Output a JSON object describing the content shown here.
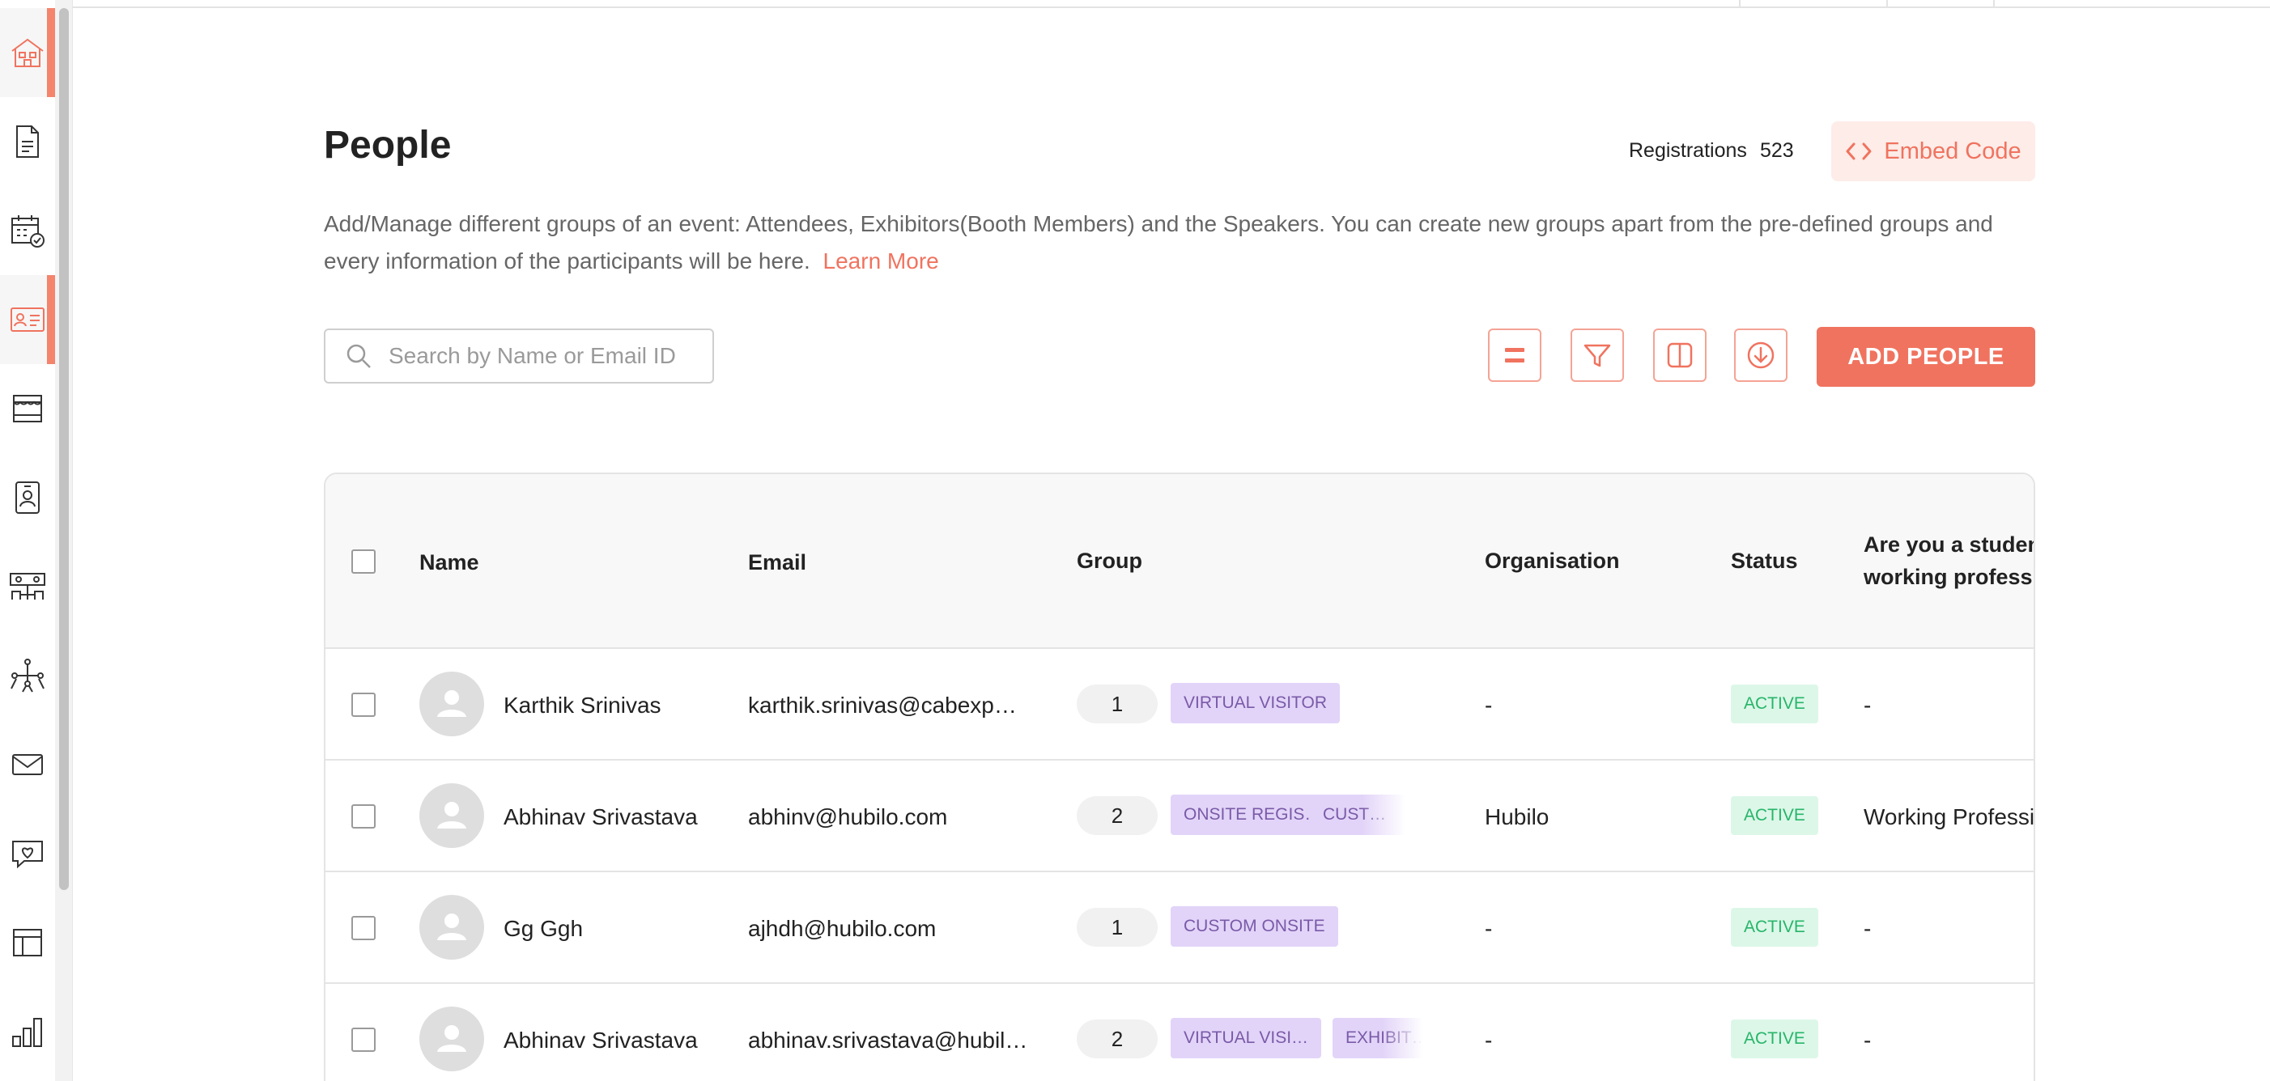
{
  "sidebar": {
    "items": [
      {
        "icon": "home-icon",
        "active": true
      },
      {
        "icon": "document-icon",
        "active": false
      },
      {
        "icon": "calendar-check-icon",
        "active": false
      },
      {
        "icon": "id-card-icon",
        "active": true
      },
      {
        "icon": "booth-icon",
        "active": false
      },
      {
        "icon": "badge-icon",
        "active": false
      },
      {
        "icon": "meeting-table-icon",
        "active": false
      },
      {
        "icon": "networking-icon",
        "active": false
      },
      {
        "icon": "mail-icon",
        "active": false
      },
      {
        "icon": "chat-heart-icon",
        "active": false
      },
      {
        "icon": "layout-icon",
        "active": false
      },
      {
        "icon": "analytics-icon",
        "active": false
      }
    ]
  },
  "header": {
    "title": "People",
    "registrations_label": "Registrations",
    "registrations_count": "523",
    "embed_label": "Embed Code",
    "description": "Add/Manage different groups of an event: Attendees, Exhibitors(Booth Members) and the Speakers. You can create new groups apart from the pre-defined groups and every information of the participants will be here.",
    "learn_more": "Learn More"
  },
  "toolbar": {
    "search_placeholder": "Search by Name or Email ID",
    "add_label": "ADD PEOPLE",
    "icons": [
      "equals-icon",
      "filter-icon",
      "columns-icon",
      "download-icon"
    ]
  },
  "colors": {
    "accent": "#f0735f",
    "accent_light": "#fdece8",
    "tag_bg": "#e2d4f8",
    "tag_text": "#7a5aa8",
    "status_bg": "#dcf7e8",
    "status_text": "#27b56a"
  },
  "table": {
    "columns": {
      "name": "Name",
      "email": "Email",
      "group": "Group",
      "organisation": "Organisation",
      "status": "Status",
      "student_line1": "Are you a student",
      "student_line2": "working professio"
    },
    "rows": [
      {
        "name": "Karthik Srinivas",
        "email": "karthik.srinivas@cabexp…",
        "group_count": "1",
        "tags": [
          "VIRTUAL VISITOR"
        ],
        "organisation": "-",
        "status": "ACTIVE",
        "student": "-"
      },
      {
        "name": "Abhinav Srivastava",
        "email": "abhinv@hubilo.com",
        "group_count": "2",
        "tags": [
          "ONSITE REGIS…",
          "CUST…"
        ],
        "organisation": "Hubilo",
        "status": "ACTIVE",
        "student": "Working Professi"
      },
      {
        "name": "Gg Ggh",
        "email": "ajhdh@hubilo.com",
        "group_count": "1",
        "tags": [
          "CUSTOM ONSITE"
        ],
        "organisation": "-",
        "status": "ACTIVE",
        "student": "-"
      },
      {
        "name": "Abhinav Srivastava",
        "email": "abhinav.srivastava@hubil…",
        "group_count": "2",
        "tags": [
          "VIRTUAL VISI…",
          "EXHIBIT…"
        ],
        "organisation": "-",
        "status": "ACTIVE",
        "student": "-"
      }
    ]
  }
}
